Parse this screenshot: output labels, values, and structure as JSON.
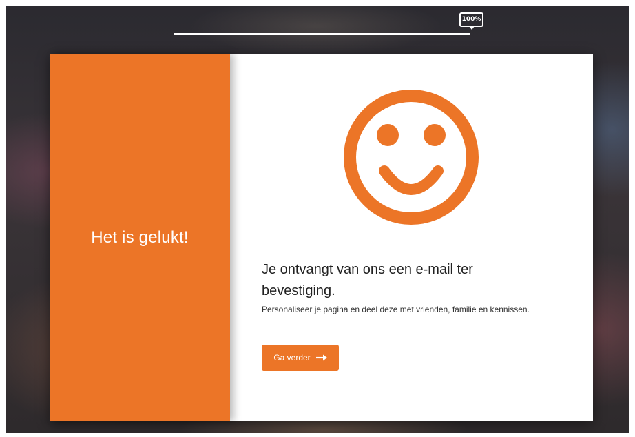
{
  "progress": {
    "label": "100%",
    "value": 1.0
  },
  "left_panel": {
    "title": "Het is gelukt!"
  },
  "main": {
    "icon": "smiley-face-icon",
    "headline": "Je ontvangt van ons een e-mail ter bevestiging.",
    "subtext": "Personaliseer je pagina en deel deze met vrienden, familie en kennissen.",
    "cta_label": "Ga verder",
    "cta_icon": "arrow-right-icon"
  },
  "colors": {
    "accent": "#ec7527",
    "card_bg": "#ffffff",
    "text": "#222222"
  }
}
